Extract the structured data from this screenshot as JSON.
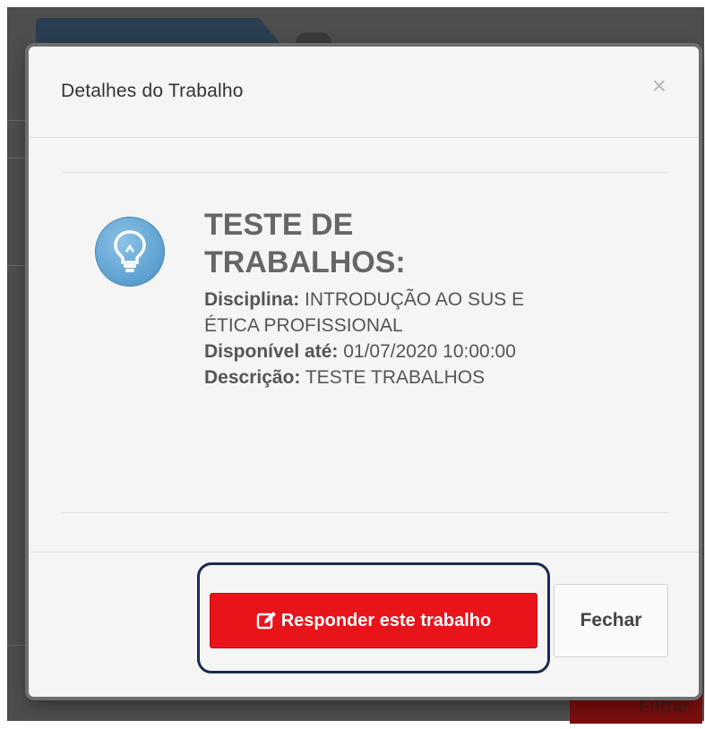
{
  "modal": {
    "title": "Detalhes do Trabalho",
    "close_symbol": "×"
  },
  "task": {
    "icon": "lightbulb-icon",
    "title": "TESTE DE TRABALHOS:",
    "discipline_label": "Disciplina:",
    "discipline_value": "INTRODUÇÃO AO SUS E ÉTICA PROFISSIONAL",
    "available_label": "Disponível até:",
    "available_value": "01/07/2020 10:00:00",
    "description_label": "Descrição:",
    "description_value": "TESTE TRABALHOS"
  },
  "footer": {
    "respond_label": "Responder este trabalho",
    "respond_icon": "edit-icon",
    "close_label": "Fechar"
  },
  "background": {
    "filter_label": "Filtrar"
  },
  "colors": {
    "primary_red": "#e8141a",
    "bulb_blue": "#5b9fd0",
    "highlight": "#1b2a52"
  }
}
